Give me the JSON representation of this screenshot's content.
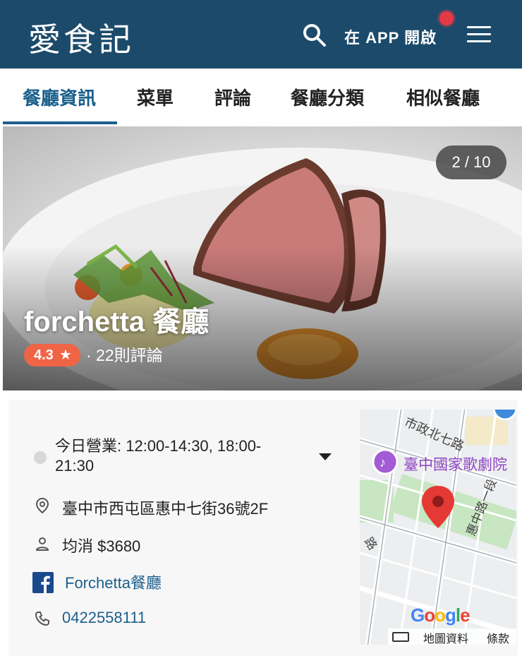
{
  "header": {
    "logo": "愛食記",
    "open_app": "在 APP 開啟"
  },
  "tabs": [
    {
      "label": "餐廳資訊",
      "active": true
    },
    {
      "label": "菜單"
    },
    {
      "label": "評論"
    },
    {
      "label": "餐廳分類"
    },
    {
      "label": "相似餐廳"
    }
  ],
  "hero": {
    "photo_counter": "2 / 10",
    "restaurant_name": "forchetta 餐廳",
    "rating": "4.3",
    "review_count": "· 22則評論"
  },
  "info": {
    "hours": "今日營業: 12:00-14:30, 18:00-21:30",
    "address": "臺中市西屯區惠中七街36號2F",
    "avg_price": "均消 $3680",
    "facebook": "Forchetta餐廳",
    "phone": "0422558111"
  },
  "map": {
    "label_opera": "臺中國家歌劇院",
    "street_north": "惠中路一段",
    "street_top": "市政北七路",
    "logo": "Google",
    "map_data": "地圖資料",
    "terms": "條款"
  },
  "colors": {
    "header_bg": "#1b4a6b",
    "tab_active": "#1b5f8c",
    "rating_badge": "#f06446",
    "link": "#1b5f8c"
  }
}
